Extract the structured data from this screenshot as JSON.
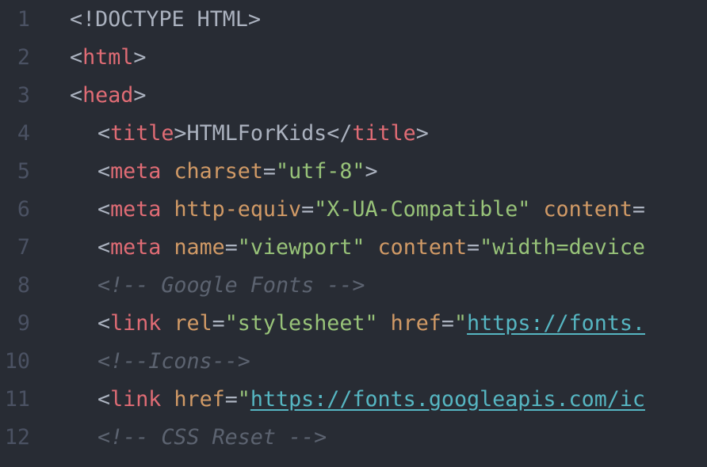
{
  "editor": {
    "lines": [
      {
        "number": "1",
        "text": "<!DOCTYPE HTML>"
      },
      {
        "number": "2",
        "open": "<",
        "tag": "html",
        "close": ">"
      },
      {
        "number": "3",
        "open": "<",
        "tag": "head",
        "close": ">"
      },
      {
        "number": "4",
        "open": "<",
        "tag": "title",
        "mid": ">",
        "content": "HTMLForKids",
        "endopen": "</",
        "endtag": "title",
        "close": ">"
      },
      {
        "number": "5",
        "open": "<",
        "tag": "meta",
        "attr1": "charset",
        "eq1": "=",
        "val1": "\"utf-8\"",
        "close": ">"
      },
      {
        "number": "6",
        "open": "<",
        "tag": "meta",
        "attr1": "http-equiv",
        "eq1": "=",
        "val1": "\"X-UA-Compatible\"",
        "attr2": "content",
        "eq2": "="
      },
      {
        "number": "7",
        "open": "<",
        "tag": "meta",
        "attr1": "name",
        "eq1": "=",
        "val1": "\"viewport\"",
        "attr2": "content",
        "eq2": "=",
        "val2": "\"width=device"
      },
      {
        "number": "8",
        "comment": "<!-- Google Fonts -->"
      },
      {
        "number": "9",
        "open": "<",
        "tag": "link",
        "attr1": "rel",
        "eq1": "=",
        "val1": "\"stylesheet\"",
        "attr2": "href",
        "eq2": "=",
        "quote": "\"",
        "url": "https://fonts."
      },
      {
        "number": "10",
        "comment": "<!--Icons-->"
      },
      {
        "number": "11",
        "open": "<",
        "tag": "link",
        "attr1": "href",
        "eq1": "=",
        "quote": "\"",
        "url": "https://fonts.googleapis.com/ic"
      },
      {
        "number": "12",
        "comment": "<!-- CSS Reset -->"
      }
    ]
  }
}
